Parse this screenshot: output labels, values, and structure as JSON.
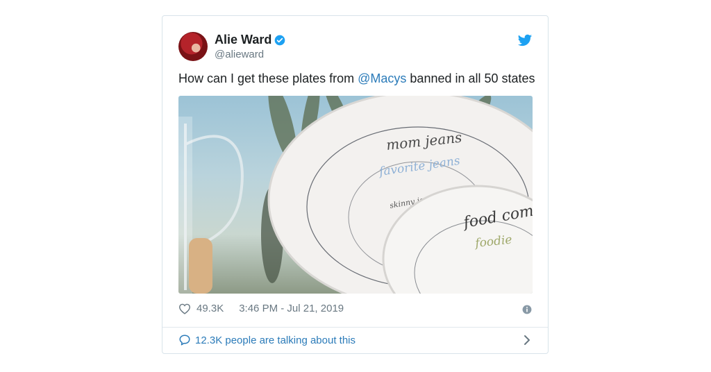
{
  "tweet": {
    "author_name": "Alie Ward",
    "handle": "@alieward",
    "text_before": "How can I get these plates from ",
    "mention": "@Macys",
    "text_after": " banned in all 50 states",
    "likes": "49.3K",
    "timestamp": "3:46 PM - Jul 21, 2019",
    "talking": "12.3K people are talking about this"
  },
  "photo": {
    "plate_large_lines": [
      "mom jeans",
      "favorite jeans",
      "skinny jeans"
    ],
    "plate_small_lines": [
      "food coma",
      "foodie"
    ]
  },
  "colors": {
    "link": "#2b7bb9",
    "muted": "#697882",
    "twitter_blue": "#1da1f2"
  },
  "icons": [
    "verified-badge-icon",
    "twitter-bird-icon",
    "heart-icon",
    "info-icon",
    "speech-bubble-icon",
    "chevron-right-icon"
  ]
}
